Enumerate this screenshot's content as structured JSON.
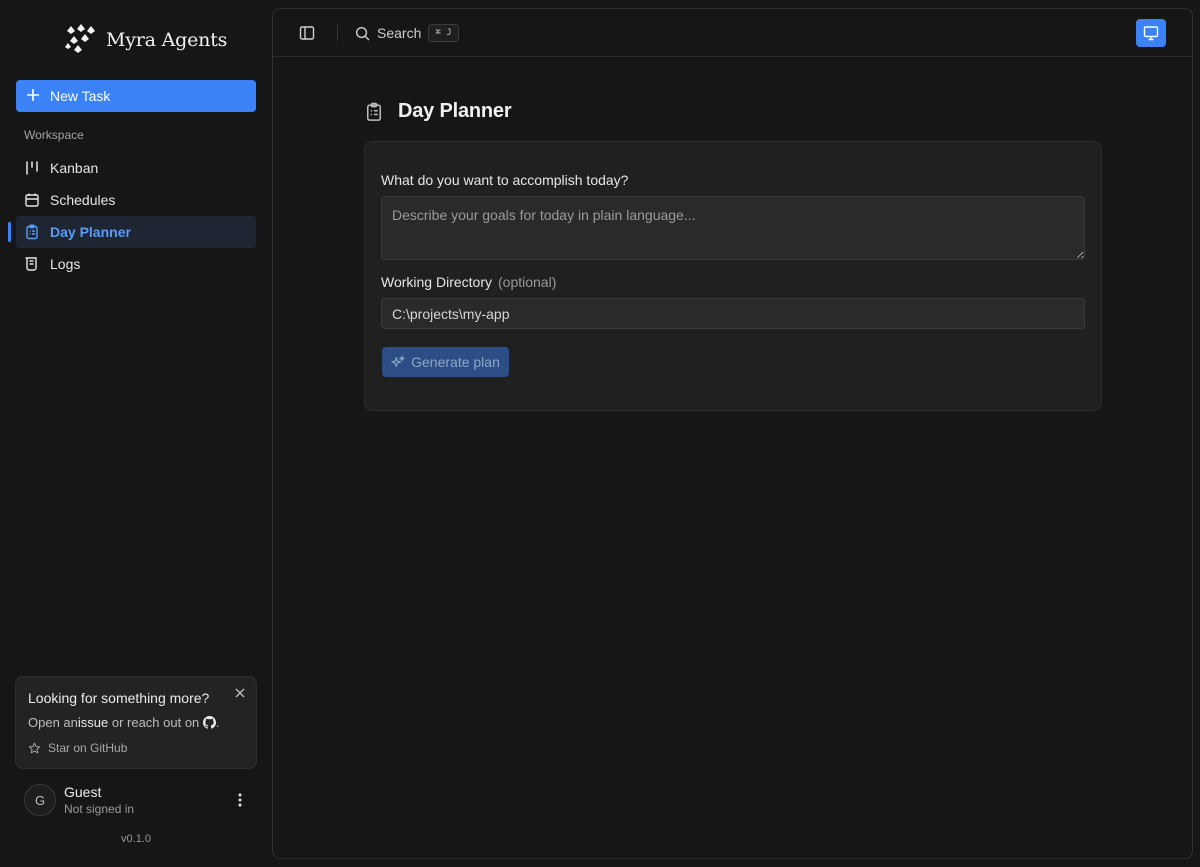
{
  "app": {
    "name": "Myra Agents",
    "version": "v0.1.0"
  },
  "sidebar": {
    "new_task_label": "New Task",
    "section_label": "Workspace",
    "items": [
      {
        "label": "Kanban",
        "icon": "kanban-icon",
        "active": false
      },
      {
        "label": "Schedules",
        "icon": "calendar-icon",
        "active": false
      },
      {
        "label": "Day Planner",
        "icon": "clipboard-icon",
        "active": true
      },
      {
        "label": "Logs",
        "icon": "scroll-icon",
        "active": false
      }
    ],
    "promo": {
      "title": "Looking for something more?",
      "body_prefix": "Open an ",
      "issue_link": "issue",
      "body_middle": " or reach out on ",
      "body_suffix": ".",
      "star_label": "Star on GitHub"
    },
    "user": {
      "initial": "G",
      "name": "Guest",
      "status": "Not signed in"
    }
  },
  "topbar": {
    "search_label": "Search",
    "search_shortcut": "⌘ J"
  },
  "page": {
    "title": "Day Planner",
    "goals_label": "What do you want to accomplish today?",
    "goals_placeholder": "Describe your goals for today in plain language...",
    "goals_value": "",
    "dir_label": "Working Directory",
    "dir_optional": "(optional)",
    "dir_value": "C:\\projects\\my-app",
    "generate_label": "Generate plan"
  },
  "colors": {
    "accent": "#3b82f6",
    "background": "#161616",
    "card": "#202020",
    "active_nav_bg": "#1e2633"
  }
}
